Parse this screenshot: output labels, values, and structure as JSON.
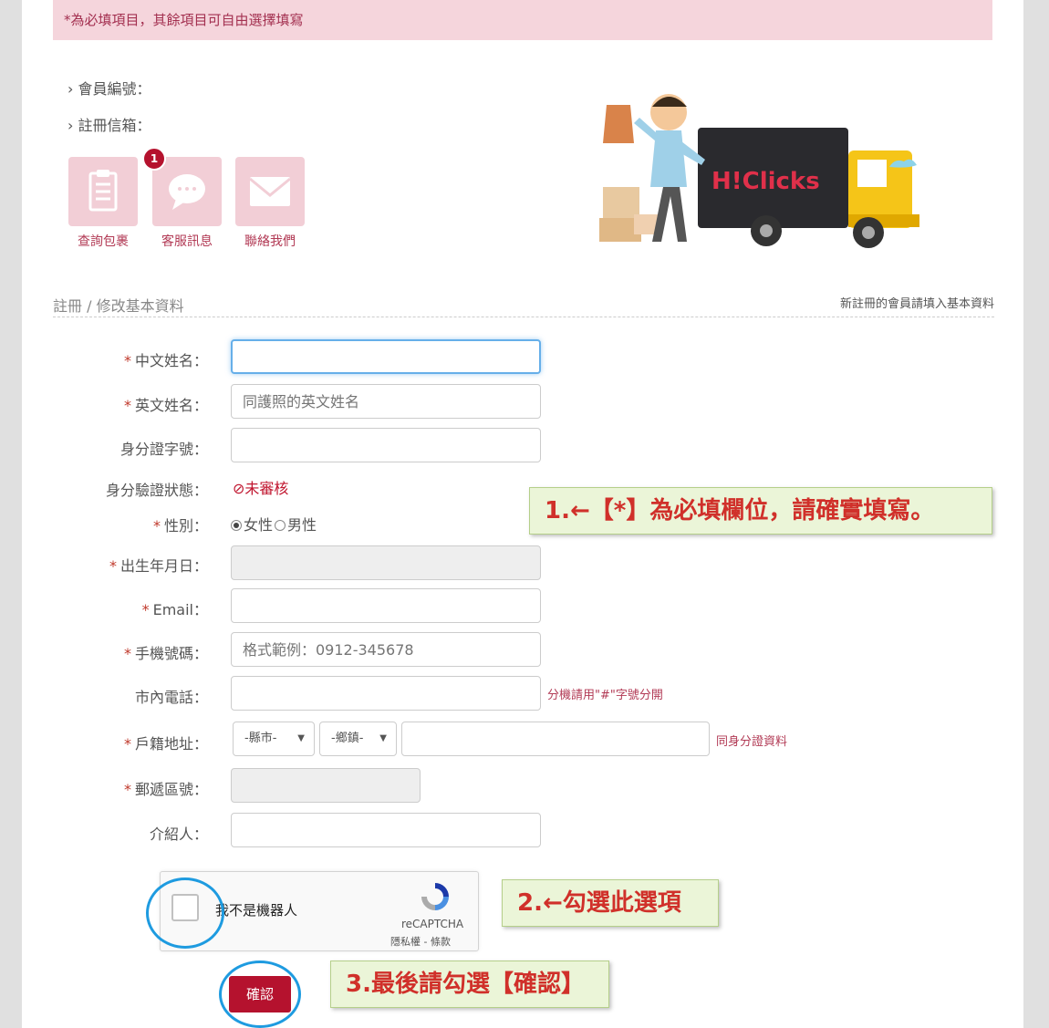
{
  "notice": "*為必填項目，其餘項目可自由選擇填寫",
  "member": {
    "id_label": "› 會員編號：",
    "email_label": "› 註冊信箱："
  },
  "quick_links": [
    {
      "label": "查詢包裹",
      "icon": "clipboard-icon"
    },
    {
      "label": "客服訊息",
      "icon": "chat-bubble-icon",
      "badge": "1"
    },
    {
      "label": "聯絡我們",
      "icon": "envelope-icon"
    }
  ],
  "banner": {
    "brand": "H!Clicks"
  },
  "section": {
    "title": "註冊 / 修改基本資料",
    "subtitle": "新註冊的會員請填入基本資料"
  },
  "form": {
    "chinese_name": {
      "label": "中文姓名：",
      "value": ""
    },
    "english_name": {
      "label": "英文姓名：",
      "placeholder": "同護照的英文姓名"
    },
    "id_number": {
      "label": "身分證字號："
    },
    "id_status": {
      "label": "身分驗證狀態：",
      "value": "⊘未審核"
    },
    "gender": {
      "label": "性別：",
      "options": [
        "女性",
        "男性"
      ],
      "selected": "女性"
    },
    "birthday": {
      "label": "出生年月日："
    },
    "email": {
      "label": "Email："
    },
    "mobile": {
      "label": "手機號碼：",
      "placeholder": "格式範例：0912-345678"
    },
    "phone": {
      "label": "市內電話：",
      "hint": "分機請用\"#\"字號分開"
    },
    "address": {
      "label": "戶籍地址：",
      "county": "-縣市-",
      "town": "-鄉鎮-",
      "hint": "同身分證資料"
    },
    "zip": {
      "label": "郵遞區號："
    },
    "referrer": {
      "label": "介紹人："
    },
    "required_mark": "*"
  },
  "captcha": {
    "label": "我不是機器人",
    "brand": "reCAPTCHA",
    "links": "隱私權 - 條款"
  },
  "submit_label": "確認",
  "callouts": {
    "one": "1.←【*】為必填欄位，請確實填寫。",
    "two": "2.←勾選此選項",
    "three": "3.最後請勾選【確認】"
  },
  "colors": {
    "accent": "#b5122e",
    "callout_bg": "#ebf5d8",
    "circle": "#1e9be0"
  }
}
